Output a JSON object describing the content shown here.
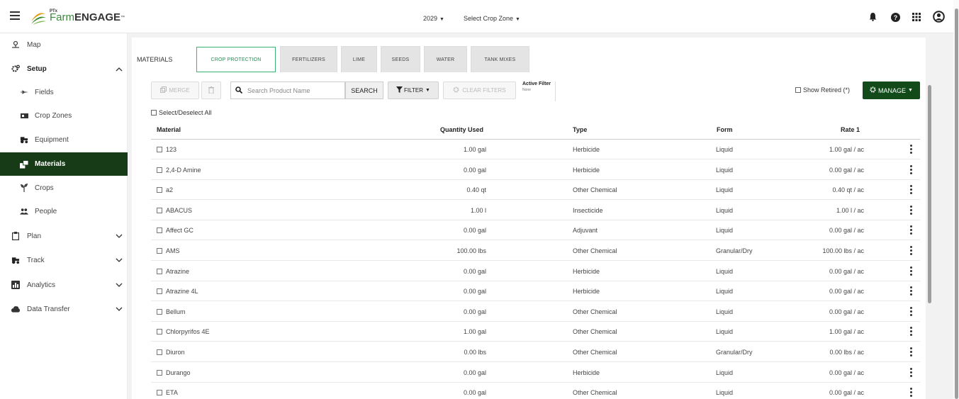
{
  "app": {
    "logo_sup": "PTx",
    "logo_farm": "Farm",
    "logo_engage": "ENGAGE",
    "logo_tm": "™",
    "year": "2029",
    "crop_zone": "Select Crop Zone",
    "brand_color": "#124a1a",
    "accent_color": "#3a8a3a"
  },
  "topbar_icons": [
    "bell-icon",
    "help-icon",
    "apps-grid-icon",
    "account-icon"
  ],
  "sidebar": {
    "map": "Map",
    "setup": "Setup",
    "fields": "Fields",
    "crop_zones": "Crop Zones",
    "equipment": "Equipment",
    "materials": "Materials",
    "crops": "Crops",
    "people": "People",
    "plan": "Plan",
    "track": "Track",
    "analytics": "Analytics",
    "data_transfer": "Data Transfer"
  },
  "tabs": {
    "label": "MATERIALS",
    "crop_protection": "CROP PROTECTION",
    "fertilizers": "FERTILIZERS",
    "lime": "LIME",
    "seeds": "SEEDS",
    "water": "WATER",
    "tank_mixes": "TANK MIXES"
  },
  "toolbar": {
    "merge": "MERGE",
    "search_placeholder": "Search Product Name",
    "search": "SEARCH",
    "filter": "FILTER",
    "clear_filters": "CLEAR FILTERS",
    "active_filter_title": "Active Filter",
    "active_filter_value": "None",
    "show_retired": "Show Retired (*)",
    "manage": "MANAGE",
    "select_all": "Select/Deselect All"
  },
  "table": {
    "headers": {
      "material": "Material",
      "quantity": "Quantity Used",
      "type": "Type",
      "form": "Form",
      "rate": "Rate 1"
    },
    "rows": [
      {
        "material": "123",
        "quantity": "1.00 gal",
        "type": "Herbicide",
        "form": "Liquid",
        "rate": "1.00 gal / ac"
      },
      {
        "material": "2,4-D Amine",
        "quantity": "0.00 gal",
        "type": "Herbicide",
        "form": "Liquid",
        "rate": "0.00 gal / ac"
      },
      {
        "material": "a2",
        "quantity": "0.40 qt",
        "type": "Other Chemical",
        "form": "Liquid",
        "rate": "0.40 qt / ac"
      },
      {
        "material": "ABACUS",
        "quantity": "1.00 l",
        "type": "Insecticide",
        "form": "Liquid",
        "rate": "1.00 l / ac"
      },
      {
        "material": "Affect GC",
        "quantity": "0.00 gal",
        "type": "Adjuvant",
        "form": "Liquid",
        "rate": "0.00 gal / ac"
      },
      {
        "material": "AMS",
        "quantity": "100.00 lbs",
        "type": "Other Chemical",
        "form": "Granular/Dry",
        "rate": "100.00 lbs / ac"
      },
      {
        "material": "Atrazine",
        "quantity": "0.00 gal",
        "type": "Herbicide",
        "form": "Liquid",
        "rate": "0.00 gal / ac"
      },
      {
        "material": "Atrazine 4L",
        "quantity": "0.00 gal",
        "type": "Herbicide",
        "form": "Liquid",
        "rate": "0.00 gal / ac"
      },
      {
        "material": "Bellum",
        "quantity": "0.00 gal",
        "type": "Other Chemical",
        "form": "Liquid",
        "rate": "0.00 gal / ac"
      },
      {
        "material": "Chlorpyrifos 4E",
        "quantity": "1.00 gal",
        "type": "Other Chemical",
        "form": "Liquid",
        "rate": "1.00 gal / ac"
      },
      {
        "material": "Diuron",
        "quantity": "0.00 lbs",
        "type": "Other Chemical",
        "form": "Granular/Dry",
        "rate": "0.00 lbs / ac"
      },
      {
        "material": "Durango",
        "quantity": "0.00 gal",
        "type": "Herbicide",
        "form": "Liquid",
        "rate": "0.00 gal / ac"
      },
      {
        "material": "ETA",
        "quantity": "0.00 gal",
        "type": "Other Chemical",
        "form": "Liquid",
        "rate": "0.00 gal / ac"
      }
    ]
  }
}
